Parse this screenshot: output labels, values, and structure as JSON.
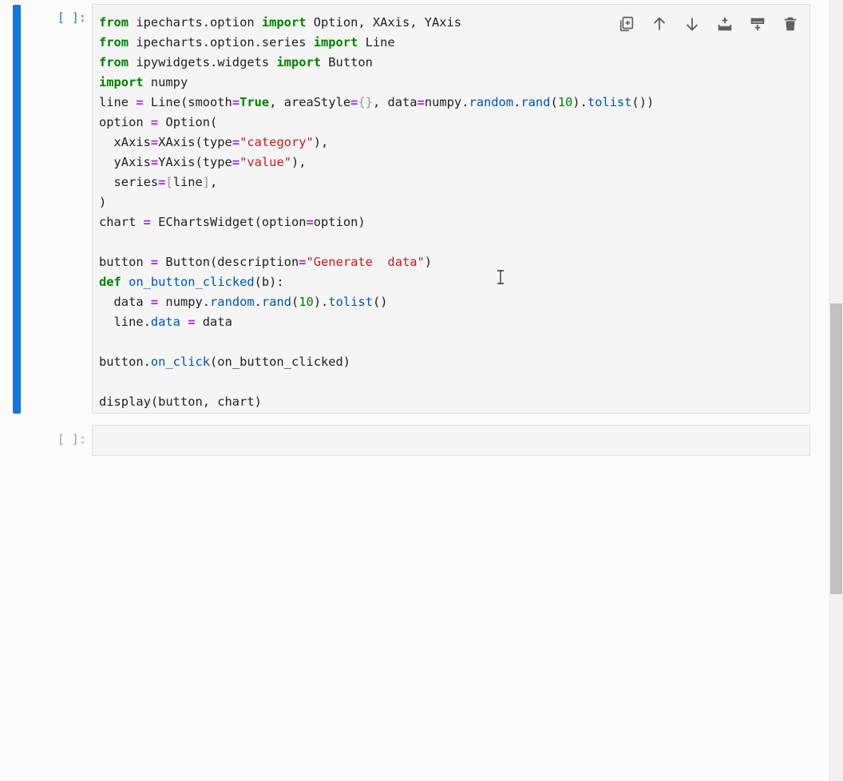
{
  "cells": [
    {
      "prompt": "[ ]:",
      "active": true,
      "code_lines": [
        "from ipecharts.option import Option, XAxis, YAxis",
        "from ipecharts.option.series import Line",
        "from ipywidgets.widgets import Button",
        "import numpy",
        "line = Line(smooth=True, areaStyle={}, data=numpy.random.rand(10).tolist())",
        "option = Option(",
        "  xAxis=XAxis(type=\"category\"),",
        "  yAxis=YAxis(type=\"value\"),",
        "  series=[line],",
        ")",
        "chart = EChartsWidget(option=option)",
        "",
        "button = Button(description=\"Generate  data\")",
        "def on_button_clicked(b):",
        "  data = numpy.random.rand(10).tolist()",
        "  line.data = data",
        "",
        "button.on_click(on_button_clicked)",
        "",
        "display(button, chart)"
      ]
    },
    {
      "prompt": "[ ]:",
      "active": false,
      "code_lines": [
        ""
      ]
    }
  ],
  "toolbar": {
    "icons": [
      "duplicate-icon",
      "move-up-icon",
      "move-down-icon",
      "insert-above-icon",
      "insert-below-icon",
      "delete-icon"
    ]
  },
  "colors": {
    "active_bar": "#1976d2",
    "editor_bg": "#f5f5f5",
    "keyword": "#008000",
    "operator": "#aa22ff",
    "string": "#ba2121"
  }
}
